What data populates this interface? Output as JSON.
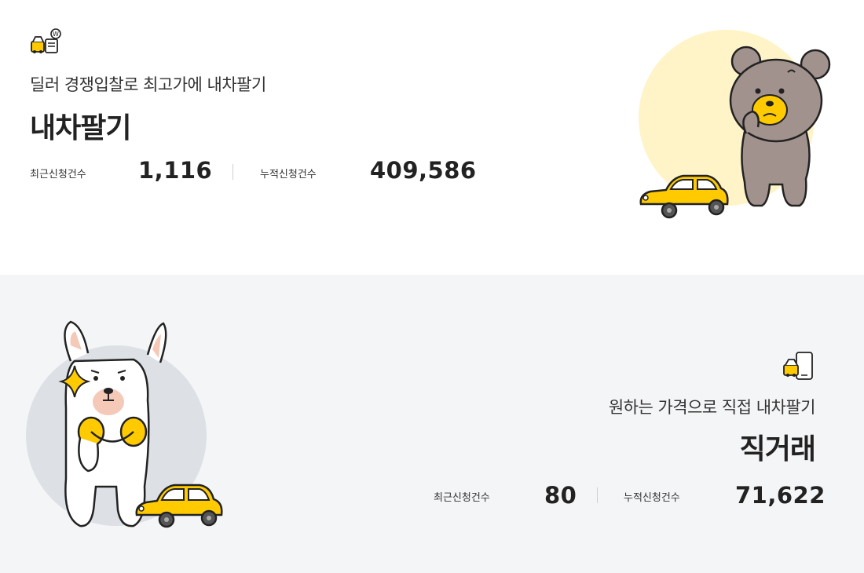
{
  "dealer_auction": {
    "subtitle": "딜러 경쟁입찰로 최고가에 내차팔기",
    "title": "내차팔기",
    "recent_label": "최근신청건수",
    "recent_value": "1,116",
    "total_label": "누적신청건수",
    "total_value": "409,586",
    "icon": "dealer-auction-icon",
    "illustration": "bear-with-car"
  },
  "direct_trade": {
    "subtitle": "원하는 가격으로 직접 내차팔기",
    "title": "직거래",
    "recent_label": "최근신청건수",
    "recent_value": "80",
    "total_label": "누적신청건수",
    "total_value": "71,622",
    "icon": "direct-trade-icon",
    "illustration": "alpaca-with-car"
  },
  "colors": {
    "accent_yellow": "#ffcb00",
    "bottom_bg": "#f4f5f7",
    "bear_circle": "#fff4c8",
    "alpaca_circle": "#dde1e5"
  }
}
